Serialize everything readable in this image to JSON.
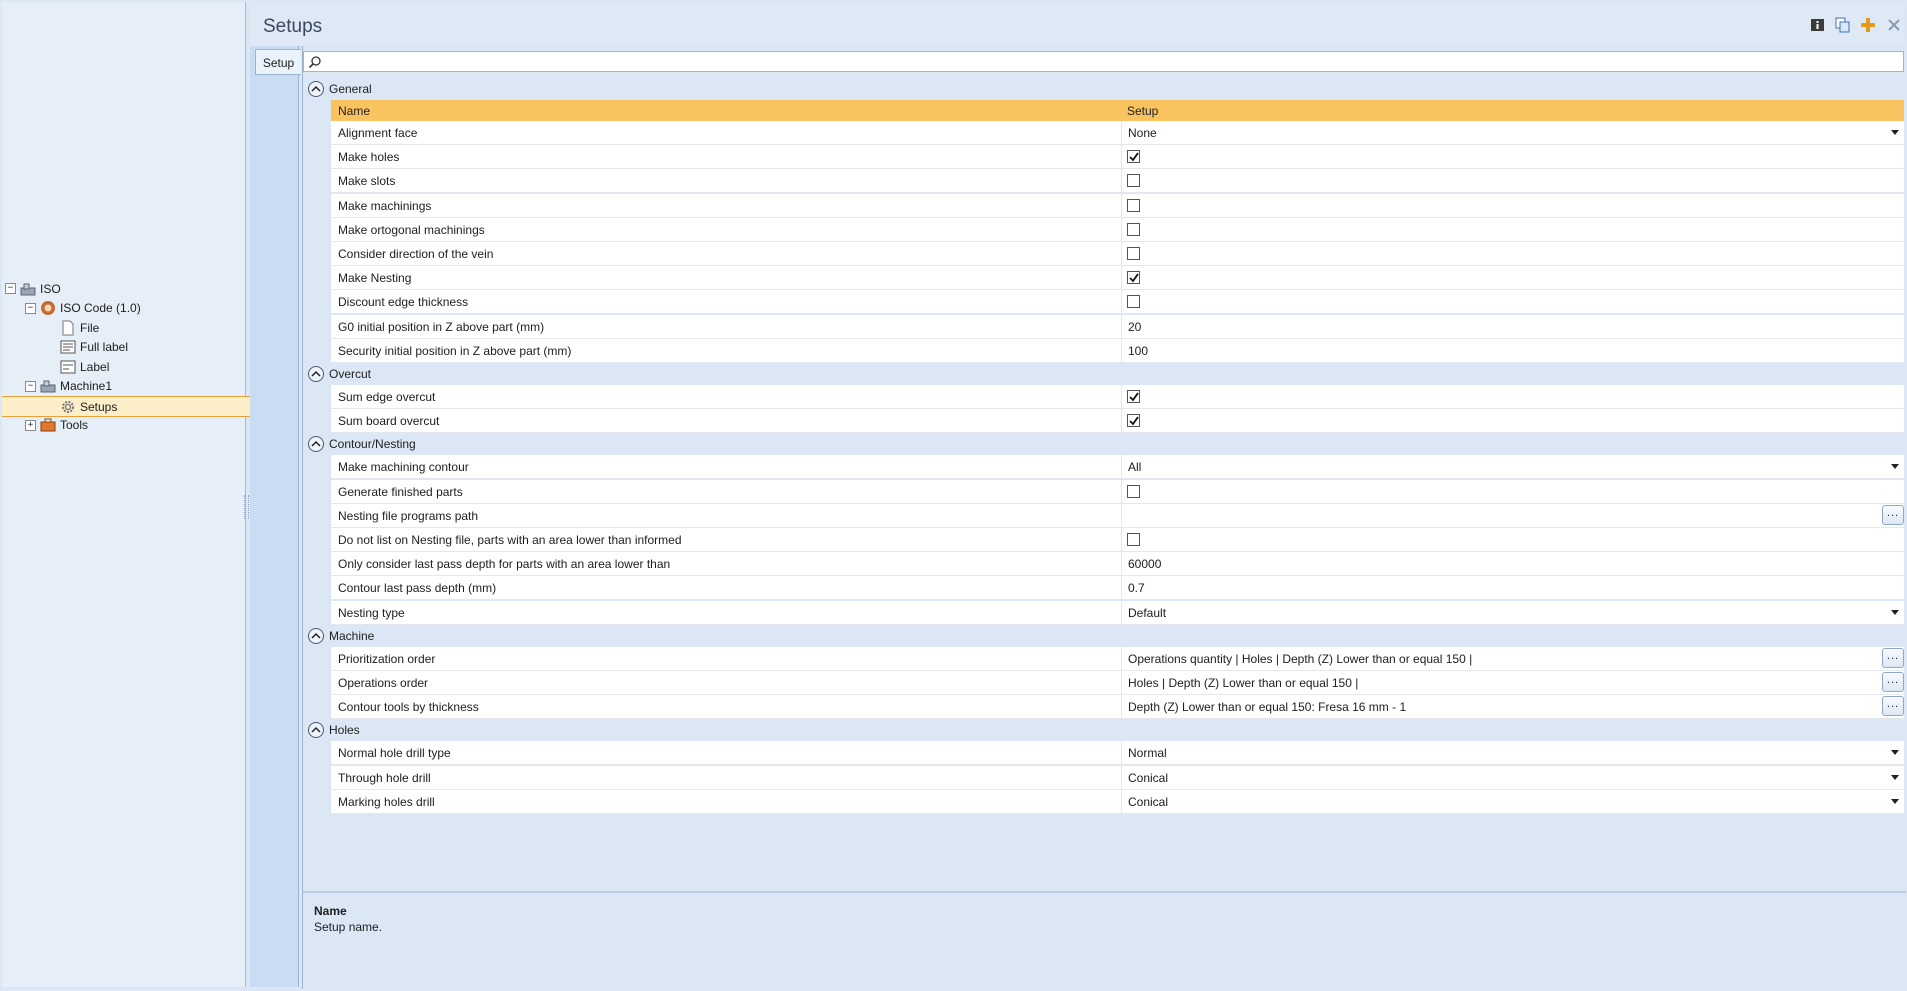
{
  "tree": {
    "nodes": [
      {
        "label": "ISO",
        "expander": "−"
      },
      {
        "label": "ISO Code (1.0)",
        "expander": "−"
      },
      {
        "label": "File"
      },
      {
        "label": "Full label"
      },
      {
        "label": "Label"
      },
      {
        "label": "Machine1",
        "expander": "−"
      },
      {
        "label": "Setups",
        "selected": true
      },
      {
        "label": "Tools",
        "expander": "+"
      }
    ]
  },
  "header": {
    "title": "Setups",
    "icons": [
      "info-icon",
      "copy-icon",
      "add-icon",
      "close-icon"
    ]
  },
  "side_tab": "Setup",
  "search": {
    "placeholder": ""
  },
  "columns": {
    "name": "Name",
    "value": "Setup"
  },
  "groups": [
    {
      "label": "General",
      "rows": [
        {
          "name": "Alignment face",
          "type": "dropdown",
          "value": "None"
        },
        {
          "name": "Make holes",
          "type": "checkbox",
          "checked": true
        },
        {
          "name": "Make slots",
          "type": "checkbox",
          "checked": false
        },
        {
          "name": "Make machinings",
          "type": "checkbox",
          "checked": false
        },
        {
          "name": "Make ortogonal machinings",
          "type": "checkbox",
          "checked": false
        },
        {
          "name": "Consider direction of the vein",
          "type": "checkbox",
          "checked": false
        },
        {
          "name": "Make Nesting",
          "type": "checkbox",
          "checked": true
        },
        {
          "name": "Discount edge thickness",
          "type": "checkbox",
          "checked": false
        },
        {
          "name": "G0 initial position in Z above part (mm)",
          "type": "text",
          "value": "20"
        },
        {
          "name": "Security initial position in Z above part (mm)",
          "type": "text",
          "value": "100"
        }
      ]
    },
    {
      "label": "Overcut",
      "rows": [
        {
          "name": "Sum edge overcut",
          "type": "checkbox",
          "checked": true
        },
        {
          "name": "Sum board overcut",
          "type": "checkbox",
          "checked": true
        }
      ]
    },
    {
      "label": "Contour/Nesting",
      "rows": [
        {
          "name": "Make machining contour",
          "type": "dropdown",
          "value": "All"
        },
        {
          "name": "Generate finished parts",
          "type": "checkbox",
          "checked": false
        },
        {
          "name": "Nesting file programs path",
          "type": "ellipsis",
          "value": ""
        },
        {
          "name": "Do not list on Nesting file, parts with an area lower than informed",
          "type": "checkbox",
          "checked": false
        },
        {
          "name": "Only consider last pass depth for parts with an area lower than",
          "type": "text",
          "value": "60000"
        },
        {
          "name": "Contour last pass depth (mm)",
          "type": "text",
          "value": "0.7"
        },
        {
          "name": "Nesting type",
          "type": "dropdown",
          "value": "Default"
        }
      ]
    },
    {
      "label": "Machine",
      "rows": [
        {
          "name": "Prioritization order",
          "type": "ellipsis",
          "value": "Operations quantity | Holes | Depth (Z) Lower than or equal 150 |"
        },
        {
          "name": "Operations order",
          "type": "ellipsis",
          "value": "Holes | Depth (Z) Lower than or equal 150 |"
        },
        {
          "name": "Contour tools by thickness",
          "type": "ellipsis",
          "value": "Depth (Z) Lower than or equal 150: Fresa 16 mm - 1"
        }
      ]
    },
    {
      "label": "Holes",
      "rows": [
        {
          "name": "Normal hole drill type",
          "type": "dropdown",
          "value": "Normal"
        },
        {
          "name": "Through hole drill",
          "type": "dropdown",
          "value": "Conical"
        },
        {
          "name": "Marking holes drill",
          "type": "dropdown",
          "value": "Conical"
        }
      ]
    }
  ],
  "ellipsis_label": "...",
  "description": {
    "title": "Name",
    "text": "Setup name."
  },
  "colors": {
    "header_row": "#f9c35f",
    "selected_node": "#fbeec8",
    "accent_border": "#e6a13a"
  }
}
